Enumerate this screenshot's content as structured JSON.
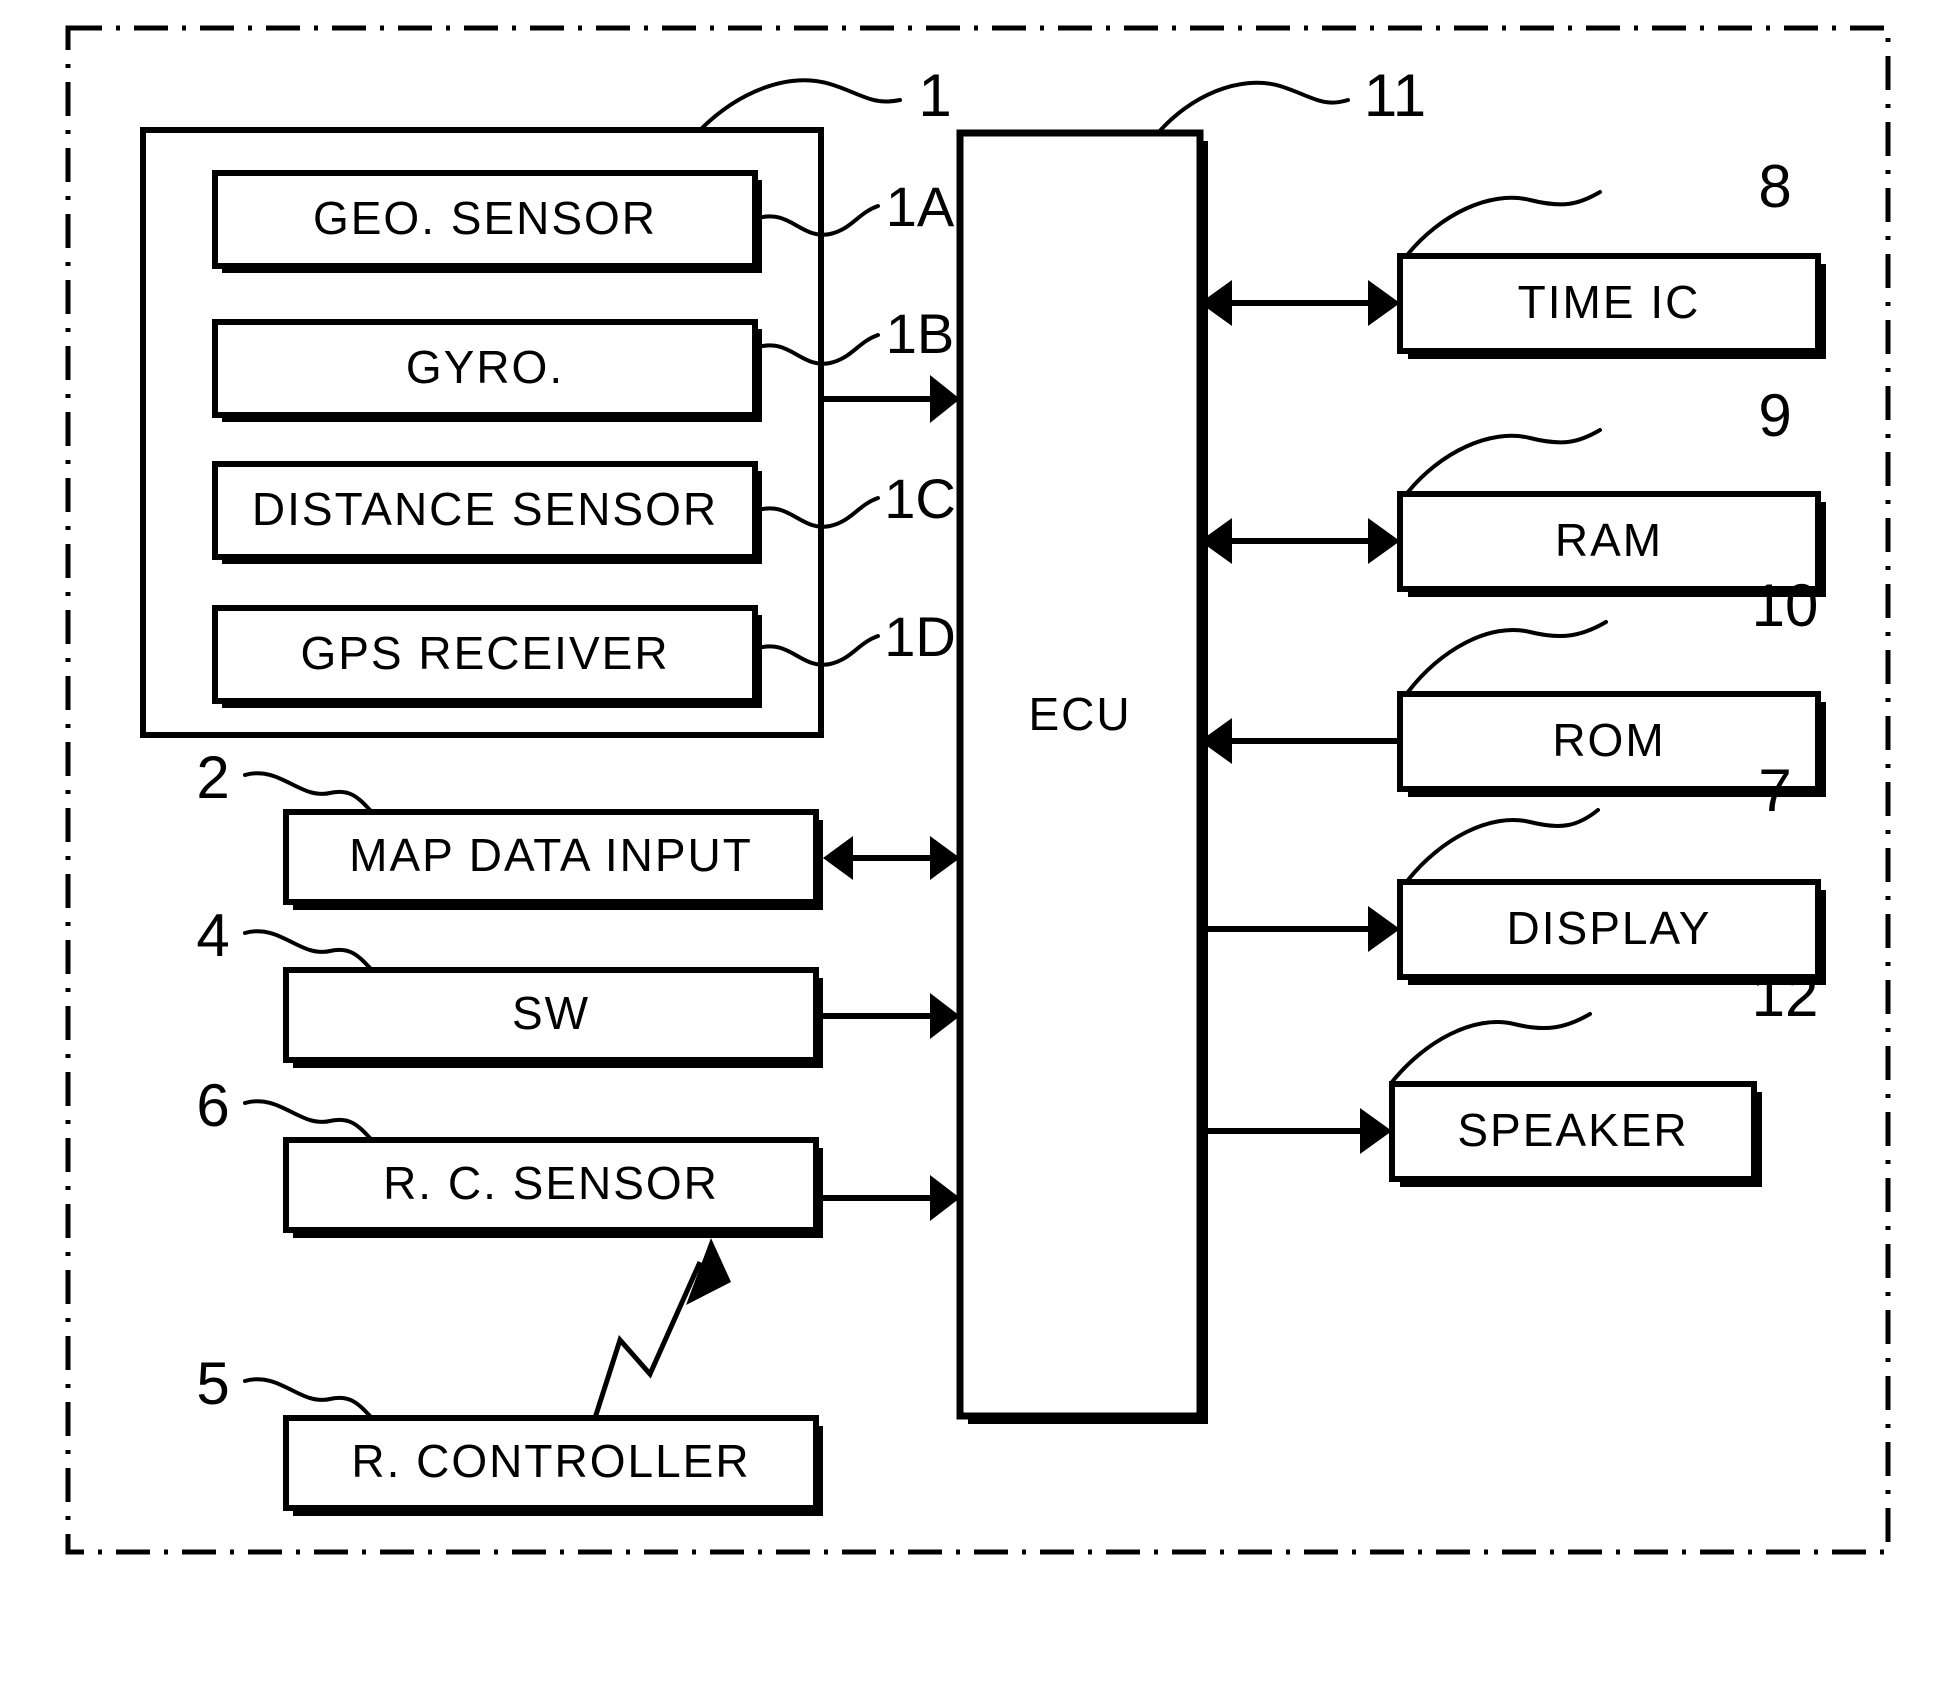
{
  "figure": {
    "title": "Vehicle navigation system block diagram",
    "outer_frame_style": "dash-dot"
  },
  "sensor_group": {
    "ref": "1",
    "items": [
      {
        "label": "GEO.  SENSOR",
        "ref": "1A"
      },
      {
        "label": "GYRO.",
        "ref": "1B"
      },
      {
        "label": "DISTANCE SENSOR",
        "ref": "1C"
      },
      {
        "label": "GPS RECEIVER",
        "ref": "1D"
      }
    ]
  },
  "left_column": [
    {
      "label": "MAP DATA INPUT",
      "ref": "2"
    },
    {
      "label": "SW",
      "ref": "4"
    },
    {
      "label": "R. C.  SENSOR",
      "ref": "6"
    },
    {
      "label": "R.  CONTROLLER",
      "ref": "5"
    }
  ],
  "ecu": {
    "label": "ECU",
    "ref": "11"
  },
  "right_column": [
    {
      "label": "TIME IC",
      "ref": "8"
    },
    {
      "label": "RAM",
      "ref": "9"
    },
    {
      "label": "ROM",
      "ref": "10"
    },
    {
      "label": "DISPLAY",
      "ref": "7"
    },
    {
      "label": "SPEAKER",
      "ref": "12"
    }
  ],
  "colors": {
    "line": "#000000",
    "background": "#ffffff"
  }
}
